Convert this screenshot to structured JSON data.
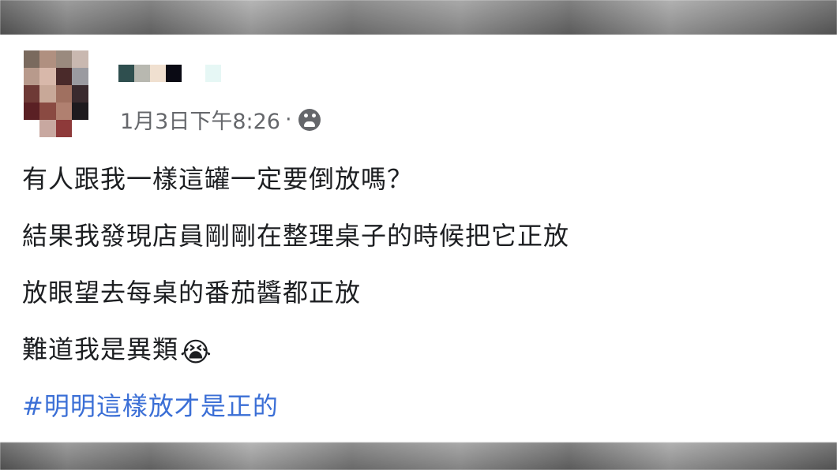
{
  "post": {
    "timestamp": "1月3日下午8:26",
    "separator": "·",
    "privacy_icon": "public-friends-icon",
    "lines": [
      "有人跟我一樣這罐一定要倒放嗎？",
      "結果我發現店員剛剛在整理桌子的時候把它正放",
      "放眼望去每桌的番茄醬都正放",
      "難道我是異類"
    ],
    "emoji": "😭",
    "hashtag": "#明明這樣放才是正的"
  },
  "colors": {
    "text": "#1c1e21",
    "meta": "#65676b",
    "hashtag": "#3b6fd6"
  }
}
